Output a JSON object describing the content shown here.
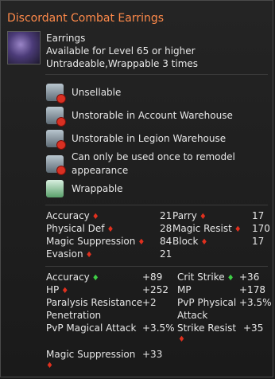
{
  "title": "Discordant Combat Earrings",
  "item": {
    "type": "Earrings",
    "level_req": "Available for Level 65 or higher",
    "trade": "Untradeable,Wrappable 3 times"
  },
  "restrictions": [
    {
      "label": "Unsellable",
      "icon": "no-sell-icon"
    },
    {
      "label": "Unstorable in Account Warehouse",
      "icon": "no-account-warehouse-icon"
    },
    {
      "label": "Unstorable in Legion Warehouse",
      "icon": "no-legion-warehouse-icon"
    },
    {
      "label_line1": "Can only be used once to remodel",
      "label_line2": "appearance",
      "icon": "remodel-once-icon"
    },
    {
      "label": "Wrappable",
      "icon": "wrappable-icon"
    }
  ],
  "base_stats": {
    "left": [
      {
        "name": "Accuracy",
        "value": "21"
      },
      {
        "name": "Physical Def",
        "value": "28"
      },
      {
        "name": "Magic Suppression",
        "value": "84"
      },
      {
        "name": "Evasion",
        "value": "21"
      }
    ],
    "right": [
      {
        "name": "Parry",
        "value": "17"
      },
      {
        "name": "Magic Resist",
        "value": "170"
      },
      {
        "name": "Block",
        "value": "17"
      }
    ]
  },
  "bonus_stats": {
    "accuracy": {
      "name": "Accuracy",
      "value": "+89"
    },
    "crit": {
      "name": "Crit Strike",
      "value": "+36"
    },
    "hp": {
      "name": "HP",
      "value": "+252"
    },
    "mp": {
      "name": "MP",
      "value": "+178"
    },
    "paralysis_line1": "Paralysis Resistance",
    "paralysis_line2": "Penetration",
    "paralysis_value": "+2",
    "pvp_phys_line1": "PvP Physical",
    "pvp_phys_line2": "Attack",
    "pvp_phys_value": "+3.5%",
    "pvp_mag": {
      "name": "PvP Magical Attack",
      "value": "+3.5%"
    },
    "strike_resist": {
      "name": "Strike Resist",
      "value": "+35"
    },
    "magic_supp": {
      "name": "Magic Suppression",
      "value": "+33"
    }
  },
  "colors": {
    "title": "#ff8a4a",
    "down_arrow": "#e0301e",
    "up_arrow": "#3fcf46"
  }
}
